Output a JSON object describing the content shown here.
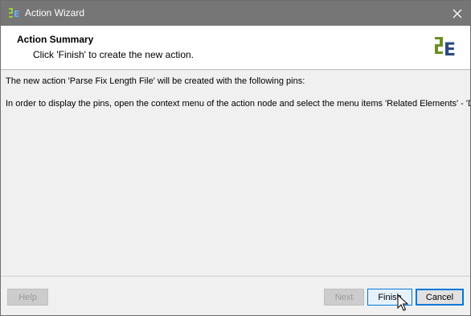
{
  "window": {
    "title": "Action Wizard"
  },
  "header": {
    "title": "Action Summary",
    "subtitle": "Click 'Finish' to create the new action."
  },
  "content": {
    "line1": "The new action 'Parse Fix Length File' will be created with the following pins:",
    "line2": "In order to display the pins, open the context menu of the action node and select the menu items 'Related Elements' - 'D"
  },
  "buttons": {
    "help": "Help",
    "next": "Next",
    "finish": "Finish",
    "cancel": "Cancel"
  },
  "icons": {
    "app": "app-logo-icon",
    "close": "close-icon",
    "logo": "brand-logo-icon",
    "cursor": "mouse-cursor-icon"
  },
  "colors": {
    "titlebar": "#767676",
    "logo_green": "#6b8e23",
    "logo_blue": "#2b4a80",
    "accent": "#0078d7"
  }
}
